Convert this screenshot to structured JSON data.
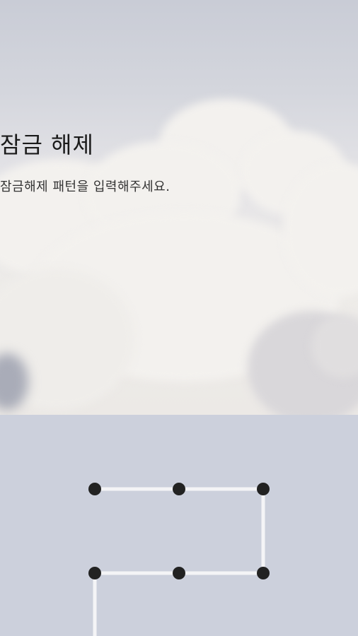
{
  "header": {
    "title": "잠금 해제",
    "subtitle": "잠금해제 패턴을 입력해주세요."
  },
  "pattern_pad": {
    "dot_color": "#222222",
    "line_color": "#f4f4f6",
    "background": "#ccd0dc"
  }
}
